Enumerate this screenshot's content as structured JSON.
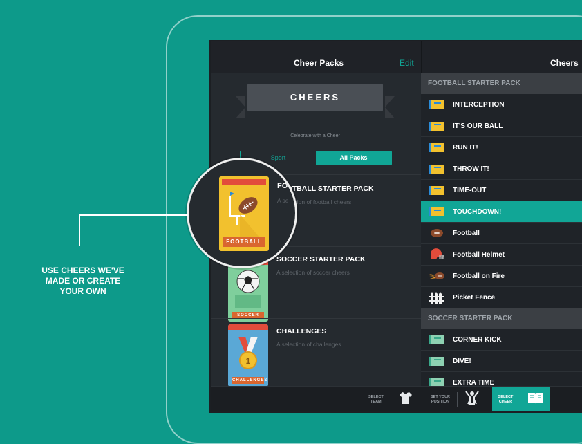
{
  "header": {
    "left_title": "Cheer Packs",
    "edit_label": "Edit",
    "right_title": "Cheers"
  },
  "banner": {
    "title": "CHEERS",
    "subtitle": "Celebrate with a Cheer"
  },
  "segmented": {
    "sport": "Sport",
    "all_packs": "All Packs"
  },
  "packs": [
    {
      "title": "FOOTBALL STARTER PACK",
      "description": "A selection of football cheers",
      "card_label": "FOOTBALL"
    },
    {
      "title": "SOCCER STARTER PACK",
      "description": "A selection of soccer cheers",
      "card_label": "SOCCER"
    },
    {
      "title": "CHALLENGES",
      "description": "A selection of challenges",
      "card_label": "CHALLENGES"
    }
  ],
  "magnifier": {
    "title": "FOOTBALL STARTER PACK",
    "title_visible": "FO",
    "description": "A selection of football cheers",
    "description_visible": "A se",
    "card_label": "FOOTBALL"
  },
  "right_sections": [
    {
      "header": "FOOTBALL STARTER PACK"
    },
    {
      "header": "SOCCER STARTER PACK"
    }
  ],
  "football_items": [
    {
      "label": "INTERCEPTION",
      "icon": "flag-icon"
    },
    {
      "label": "IT'S OUR BALL",
      "icon": "flag-icon"
    },
    {
      "label": "RUN IT!",
      "icon": "flag-icon"
    },
    {
      "label": "THROW IT!",
      "icon": "flag-icon"
    },
    {
      "label": "TIME-OUT",
      "icon": "flag-icon"
    },
    {
      "label": "TOUCHDOWN!",
      "icon": "flag-icon",
      "selected": true
    },
    {
      "label": "Football",
      "icon": "football-icon"
    },
    {
      "label": "Football Helmet",
      "icon": "helmet-icon"
    },
    {
      "label": "Football on Fire",
      "icon": "fire-football-icon"
    },
    {
      "label": "Picket Fence",
      "icon": "fence-icon"
    }
  ],
  "soccer_items": [
    {
      "label": "CORNER KICK",
      "icon": "flag-icon"
    },
    {
      "label": "DIVE!",
      "icon": "flag-icon"
    },
    {
      "label": "EXTRA TIME",
      "icon": "flag-icon"
    }
  ],
  "bottom_tabs": [
    {
      "label": "SELECT\nTEAM",
      "icon": "shirt-icon"
    },
    {
      "label": "SET YOUR\nPOSITION",
      "icon": "cheerleader-icon"
    },
    {
      "label": "SELECT\nCHEER",
      "icon": "book-icon",
      "active": true
    }
  ],
  "callout": {
    "text": "USE CHEERS WE'VE\nMADE OR CREATE\nYOUR OWN"
  },
  "colors": {
    "background": "#0d9a8a",
    "accent": "#11a696",
    "screen": "#22262b"
  }
}
